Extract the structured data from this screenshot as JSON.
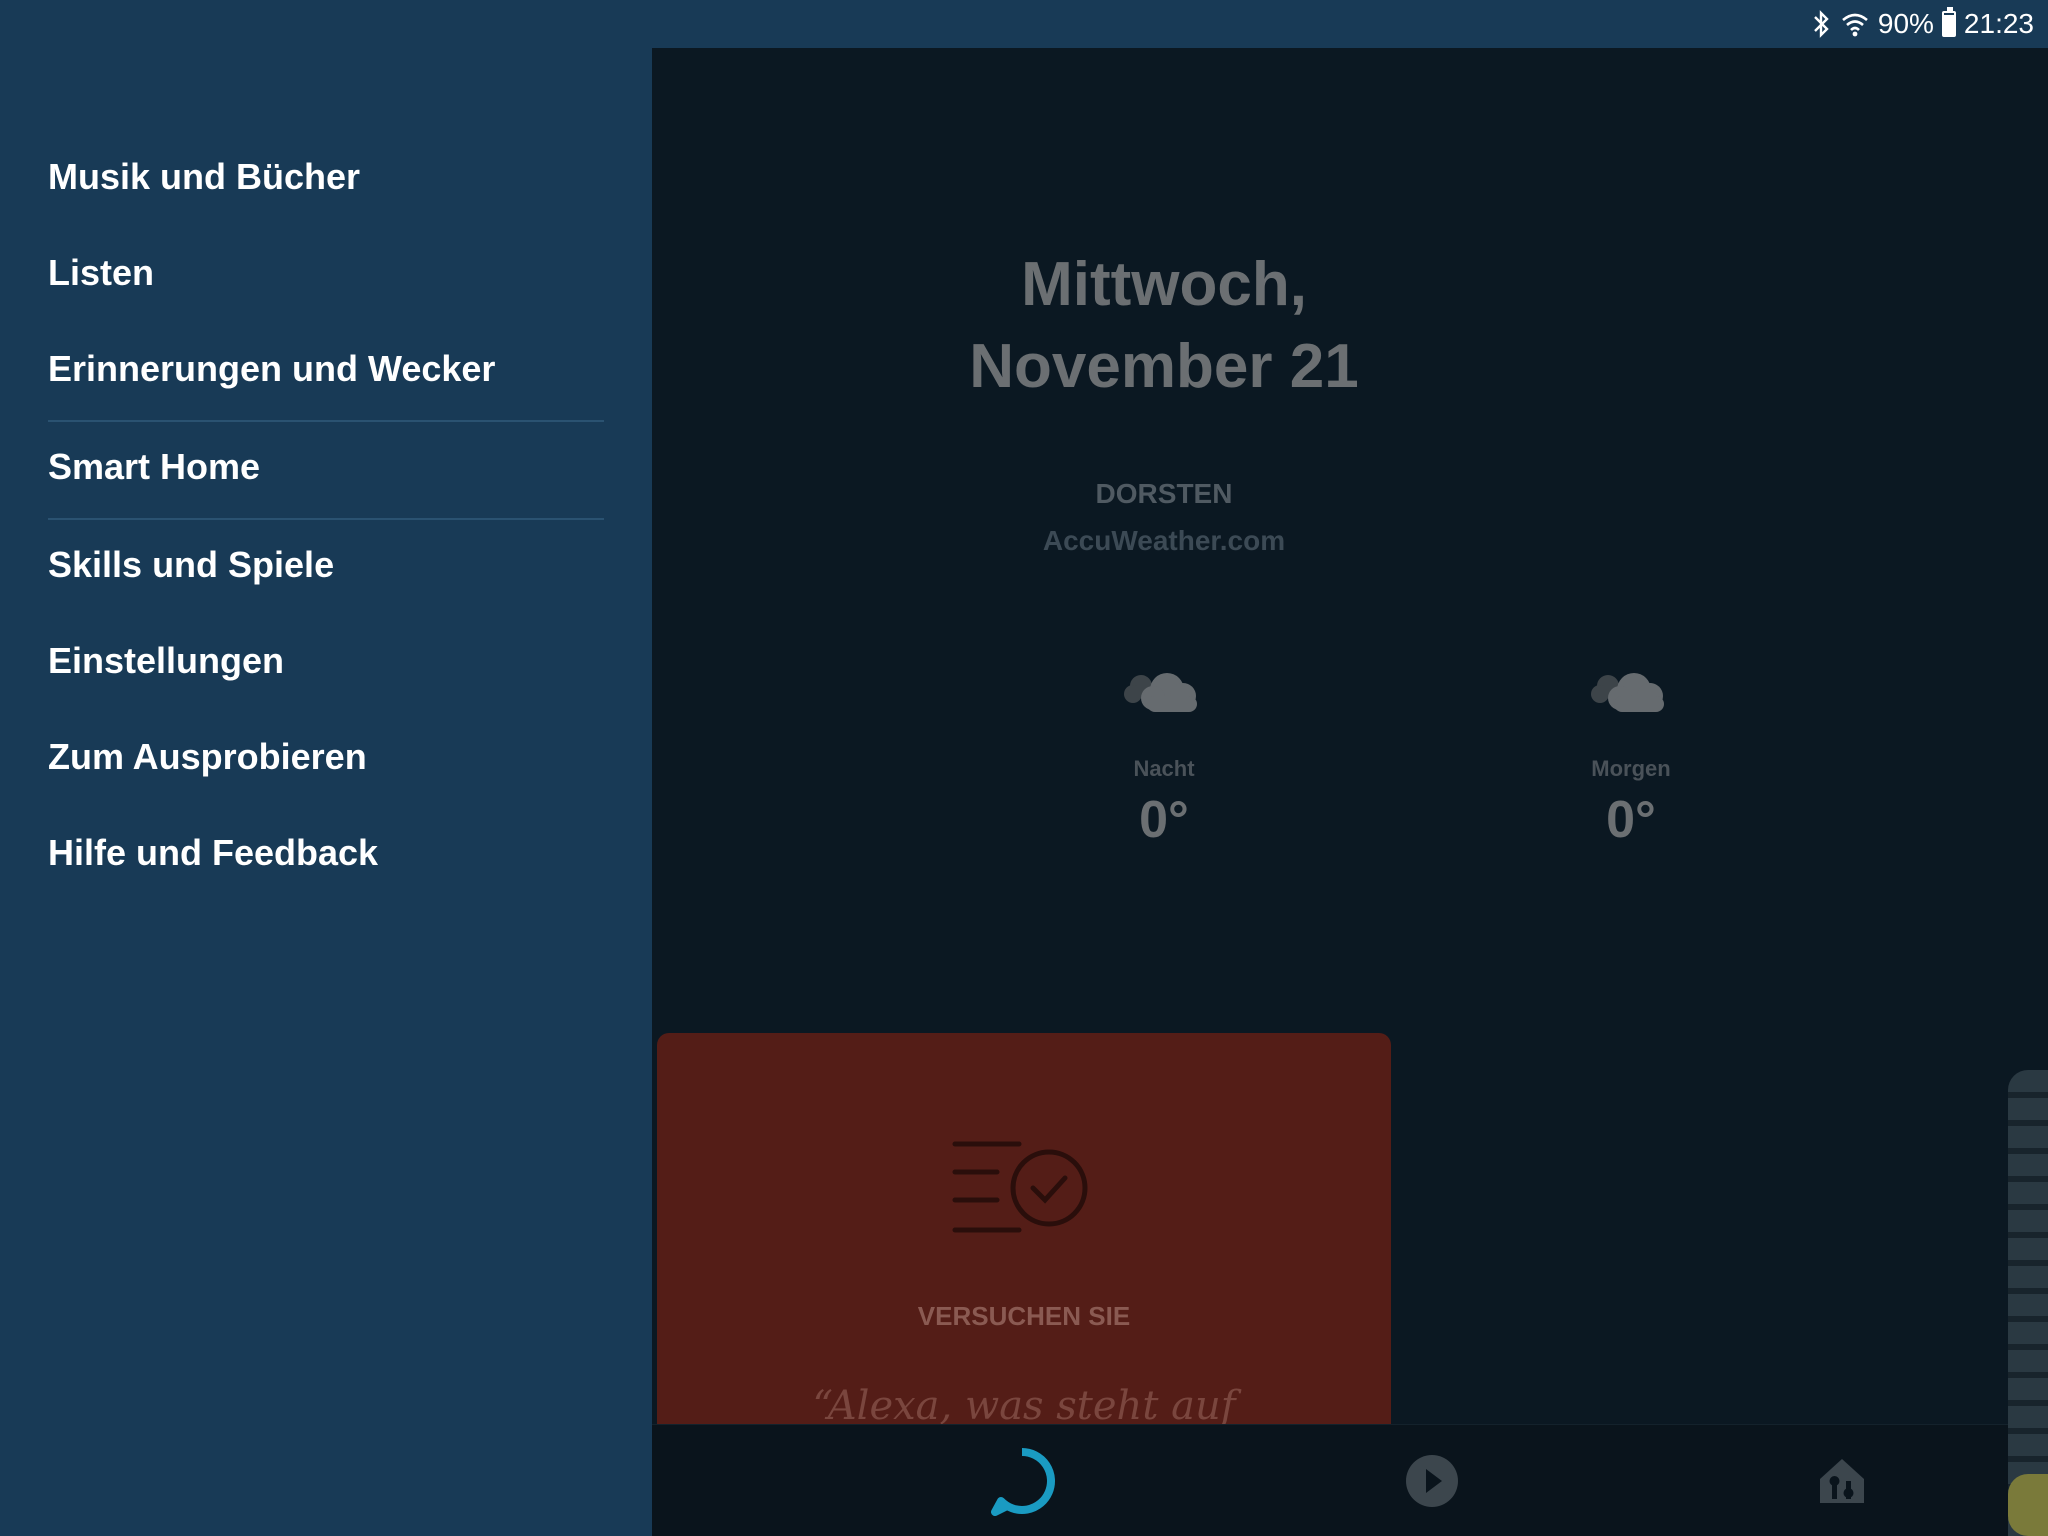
{
  "status_bar": {
    "battery": "90%",
    "time": "21:23",
    "icons": [
      "bluetooth-icon",
      "wifi-icon",
      "battery-icon"
    ]
  },
  "drawer": {
    "items": [
      {
        "label": "Musik und Bücher"
      },
      {
        "label": "Listen"
      },
      {
        "label": "Erinnerungen und Wecker"
      },
      {
        "label": "Smart Home"
      },
      {
        "label": "Skills und Spiele"
      },
      {
        "label": "Einstellungen"
      },
      {
        "label": "Zum Ausprobieren"
      },
      {
        "label": "Hilfe und Feedback"
      }
    ]
  },
  "main": {
    "date_line1": "Mittwoch,",
    "date_line2": "November 21",
    "location": "DORSTEN",
    "source": "AccuWeather.com",
    "forecast": [
      {
        "label": "Nacht",
        "temp": "0°",
        "icon": "cloud-icon"
      },
      {
        "label": "Morgen",
        "temp": "0°",
        "icon": "cloud-icon"
      }
    ],
    "card": {
      "title": "VERSUCHEN SIE",
      "quote": "“Alexa, was steht auf"
    }
  },
  "bottom_nav": {
    "items": [
      "alexa-ring-icon",
      "play-icon",
      "smart-home-icon"
    ]
  },
  "colors": {
    "drawer_bg": "#183a56",
    "main_bg": "#0b1822",
    "card_bg": "#541d17",
    "alexa_accent": "#1a9bc2"
  }
}
